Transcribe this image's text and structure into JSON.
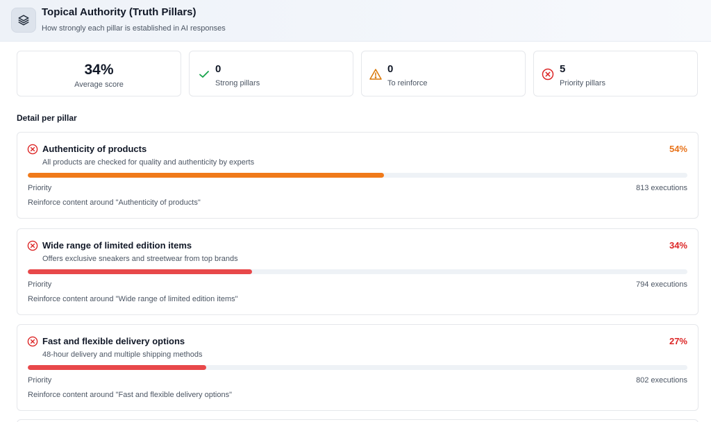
{
  "header": {
    "title": "Topical Authority (Truth Pillars)",
    "subtitle": "How strongly each pillar is established in AI responses",
    "icon": "layers-icon"
  },
  "stats": [
    {
      "value": "34%",
      "label": "Average score",
      "icon": ""
    },
    {
      "value": "0",
      "label": "Strong pillars",
      "icon": "check-icon",
      "color": "#16a34a"
    },
    {
      "value": "0",
      "label": "To reinforce",
      "icon": "warning-icon",
      "color": "#d97706"
    },
    {
      "value": "5",
      "label": "Priority pillars",
      "icon": "x-circle-icon",
      "color": "#dc2626"
    }
  ],
  "section_title": "Detail per pillar",
  "pillars": [
    {
      "title": "Authenticity of products",
      "description": "All products are checked for quality and authenticity by experts",
      "percent_label": "54%",
      "score": 0.54,
      "color": "#f07a1a",
      "status": "Priority",
      "executions": "813 executions",
      "recommendation": "Reinforce content around \"Authenticity of products\""
    },
    {
      "title": "Wide range of limited edition items",
      "description": "Offers exclusive sneakers and streetwear from top brands",
      "percent_label": "34%",
      "score": 0.34,
      "color": "#e8484a",
      "status": "Priority",
      "executions": "794 executions",
      "recommendation": "Reinforce content around \"Wide range of limited edition items\""
    },
    {
      "title": "Fast and flexible delivery options",
      "description": "48-hour delivery and multiple shipping methods",
      "percent_label": "27%",
      "score": 0.27,
      "color": "#e8484a",
      "status": "Priority",
      "executions": "802 executions",
      "recommendation": "Reinforce content around \"Fast and flexible delivery options\""
    }
  ],
  "colors": {
    "orange_text": "#e8731a",
    "red_text": "#dc2626",
    "status_x": "#dc2626"
  }
}
